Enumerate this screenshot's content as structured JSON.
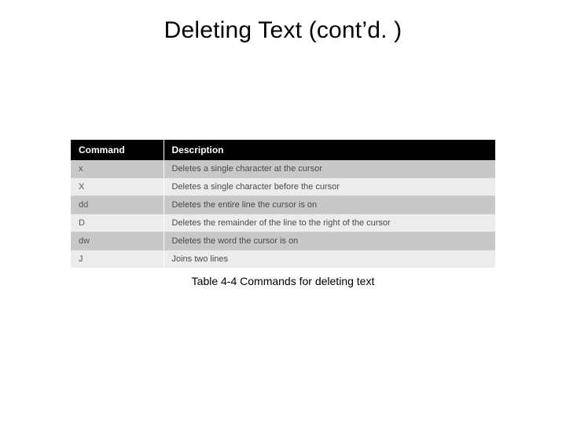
{
  "title": "Deleting Text (cont’d. )",
  "caption": "Table 4‑4 Commands for deleting text",
  "table": {
    "headers": {
      "cmd": "Command",
      "desc": "Description"
    },
    "rows": [
      {
        "cmd": "x",
        "desc": "Deletes a single character at the cursor"
      },
      {
        "cmd": "X",
        "desc": "Deletes a single character before the cursor"
      },
      {
        "cmd": "dd",
        "desc": "Deletes the entire line the cursor is on"
      },
      {
        "cmd": "D",
        "desc": "Deletes the remainder of the line to the right of the cursor"
      },
      {
        "cmd": "dw",
        "desc": "Deletes the word the cursor is on"
      },
      {
        "cmd": "J",
        "desc": "Joins two lines"
      }
    ]
  }
}
